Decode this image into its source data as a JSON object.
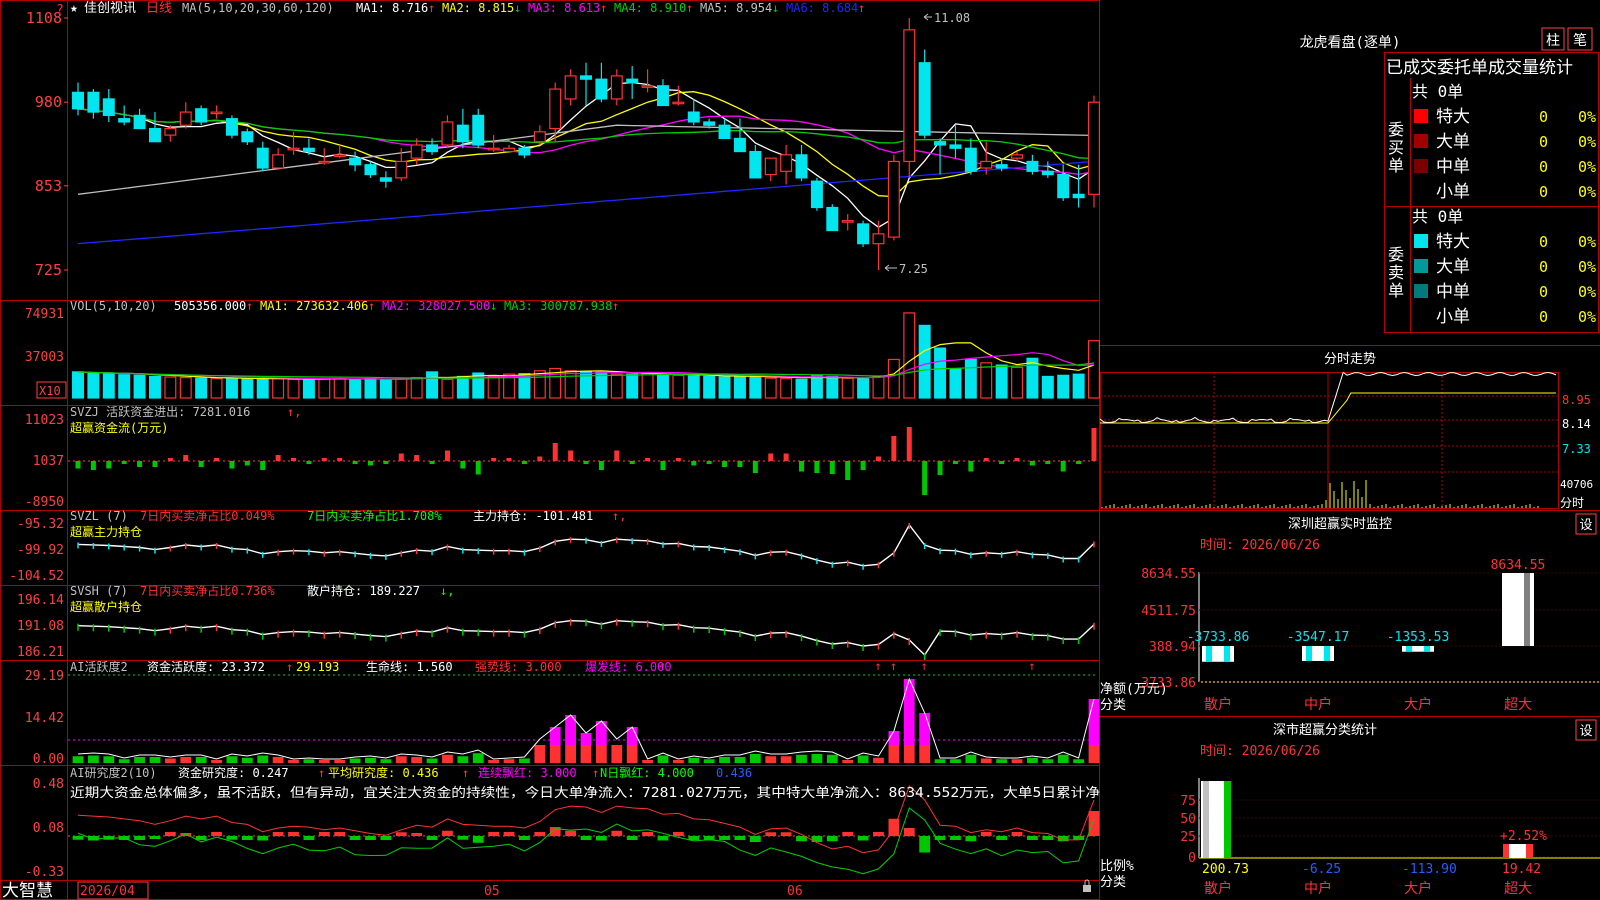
{
  "colors": {
    "up": "#ff3232",
    "down": "#00e5ee",
    "grid": "#b40000",
    "axis": "#ff4040",
    "white": "#ffffff",
    "yellow": "#ffff00",
    "magenta": "#ff00ff",
    "green": "#00d000",
    "gray": "#c0c0c0",
    "blue": "#1e28ff",
    "chinaGreen": "#00c800"
  },
  "header": {
    "star": "★",
    "stock": "佳创视讯",
    "period": "日线",
    "close_btn": "?"
  },
  "ma_label": "MA(5,10,20,30,60,120)",
  "ma_values": [
    {
      "label": "MA1: 8.716",
      "arrow": "↑",
      "color": "#ffffff"
    },
    {
      "label": "MA2: 8.815",
      "arrow": "↓",
      "color": "#ffff00"
    },
    {
      "label": "MA3: 8.613",
      "arrow": "↑",
      "color": "#ff00ff"
    },
    {
      "label": "MA4: 8.910",
      "arrow": "↑",
      "color": "#00d000"
    },
    {
      "label": "MA5: 8.954",
      "arrow": "↓",
      "color": "#c0c0c0"
    },
    {
      "label": "MA6: 8.684",
      "arrow": "↑",
      "color": "#1e28ff"
    }
  ],
  "price_axis": [
    "1108",
    "980",
    "853",
    "725"
  ],
  "price_axis_values": [
    11.08,
    9.8,
    8.53,
    7.25
  ],
  "high_label": "11.08",
  "low_label": "7.25",
  "vol": {
    "title": "VOL(5,10,20)",
    "values": [
      {
        "label": "505356.000",
        "arrow": "↑",
        "color": "#ffffff"
      },
      {
        "label": "MA1: 273632.406",
        "arrow": "↑",
        "color": "#ffff00"
      },
      {
        "label": "MA2: 328027.500",
        "arrow": "↓",
        "color": "#ff00ff"
      },
      {
        "label": "MA3: 300787.938",
        "arrow": "↑",
        "color": "#00d000"
      }
    ],
    "axis": [
      "74931",
      "37003"
    ],
    "unit": "X10"
  },
  "svzj": {
    "line1": "SVZJ  活跃资金进出: 7281.016",
    "arrow": "↑,",
    "line2": "超赢资金流(万元)",
    "axis": [
      "11023",
      "1037",
      "-8950"
    ]
  },
  "svzl": {
    "name": "SVZL (7)",
    "p1": "7日内买卖净占比0.049%",
    "p2": "7日内买卖净占比1.708%",
    "p3": "主力持仓: -101.481",
    "arrow": "↑,",
    "line2": "超赢主力持仓",
    "axis": [
      "-95.32",
      "-99.92",
      "-104.52"
    ]
  },
  "svsh": {
    "name": "SVSH (7)",
    "p1": "7日内买卖净占比0.736%",
    "p2": "散户持仓: 189.227",
    "arrow": "↓,",
    "line2": "超赢散户持仓",
    "axis": [
      "196.14",
      "191.08",
      "186.21"
    ]
  },
  "ai1": {
    "name": "AI活跃度2",
    "p1": "资金活跃度: 23.372",
    "a1": "↑",
    "p2": "29.193",
    "p3": "生命线: 1.560",
    "p4": "强势线: 3.000",
    "p5": "爆发线: 6.000",
    "axis": [
      "29.19",
      "14.42",
      "0.00"
    ]
  },
  "ai2": {
    "name": "AI研究度2(10)",
    "p1": "资金研究度: 0.247",
    "a1": "↑",
    "p2": "平均研究度: 0.436",
    "a2": "↑",
    "p3": "连续飘红: 3.000",
    "a3": "↑",
    "p4": "N日飘红: 4.000",
    "p5": "0.436",
    "commentary": "近期大资金总体偏多，虽不活跃，但有异动，宜关注大资金的持续性，今日大单净流入：7281.027万元，其中特大单净流入：8634.552万元，大单5日累计净",
    "axis": [
      "0.48",
      "0.08",
      "-0.33"
    ]
  },
  "bottom": {
    "brand": "大智慧",
    "date": "2026/04",
    "m5": "05",
    "m6": "06"
  },
  "lhb": {
    "title": "龙虎看盘(逐单)",
    "btn1": "柱",
    "btn2": "笔",
    "table_title": "已成交委托单成交量统计",
    "buy": {
      "side": [
        "委",
        "买",
        "单"
      ],
      "count": "共 0单",
      "rows": [
        {
          "name": "特大",
          "v": "0",
          "p": "0%",
          "c": "#ff0000"
        },
        {
          "name": "大单",
          "v": "0",
          "p": "0%",
          "c": "#a00000"
        },
        {
          "name": "中单",
          "v": "0",
          "p": "0%",
          "c": "#7a0000"
        },
        {
          "name": "小单",
          "v": "0",
          "p": "0%",
          "c": ""
        }
      ]
    },
    "sell": {
      "side": [
        "委",
        "卖",
        "单"
      ],
      "count": "共 0单",
      "rows": [
        {
          "name": "特大",
          "v": "0",
          "p": "0%",
          "c": "#00e5ee"
        },
        {
          "name": "大单",
          "v": "0",
          "p": "0%",
          "c": "#009a9a"
        },
        {
          "name": "中单",
          "v": "0",
          "p": "0%",
          "c": "#007a7a"
        },
        {
          "name": "小单",
          "v": "0",
          "p": "0%",
          "c": ""
        }
      ]
    }
  },
  "intraday": {
    "title": "分时走势",
    "axis": [
      "8.95",
      "8.14",
      "7.33"
    ],
    "vol_label": "40706",
    "unit": "分时"
  },
  "monitor": {
    "title": "深圳超赢实时监控",
    "btn": "设",
    "date": "时间: 2026/06/26",
    "ylabel1": "净额(万元)",
    "ylabel2": "分类",
    "axis": [
      "8634.55",
      "4511.75",
      "388.94",
      "-3733.86"
    ],
    "categories": [
      "散户",
      "中户",
      "大户",
      "超大"
    ],
    "values": [
      "-3733.86",
      "-3547.17",
      "-1353.53",
      "8634.55"
    ]
  },
  "classify": {
    "title": "深市超赢分类统计",
    "btn": "设",
    "date": "时间: 2026/06/26",
    "ylabel1": "比例%",
    "ylabel2": "分类",
    "axis": [
      "75",
      "50",
      "25",
      "0"
    ],
    "categories": [
      "散户",
      "中户",
      "大户",
      "超大"
    ],
    "values": [
      "200.73",
      "-6.25",
      "-113.90",
      "19.42"
    ],
    "extra": "+2.52%"
  },
  "chart_data": [
    {
      "type": "candlestick",
      "title": "佳创视讯 日线",
      "ylim": [
        7.25,
        11.08
      ],
      "ohlc": [
        [
          9.95,
          10.1,
          9.6,
          9.7
        ],
        [
          9.95,
          10.0,
          9.55,
          9.65
        ],
        [
          9.85,
          10.0,
          9.5,
          9.6
        ],
        [
          9.55,
          9.75,
          9.45,
          9.5
        ],
        [
          9.6,
          9.7,
          9.4,
          9.4
        ],
        [
          9.4,
          9.65,
          9.2,
          9.2
        ],
        [
          9.3,
          9.45,
          9.2,
          9.4
        ],
        [
          9.45,
          9.8,
          9.4,
          9.65
        ],
        [
          9.7,
          9.75,
          9.45,
          9.5
        ],
        [
          9.65,
          9.75,
          9.55,
          9.65
        ],
        [
          9.55,
          9.6,
          9.25,
          9.3
        ],
        [
          9.35,
          9.4,
          9.15,
          9.2
        ],
        [
          9.1,
          9.2,
          8.75,
          8.8
        ],
        [
          8.8,
          9.1,
          8.8,
          9.0
        ],
        [
          9.1,
          9.35,
          9.0,
          9.1
        ],
        [
          9.1,
          9.25,
          9.0,
          9.05
        ],
        [
          8.9,
          9.1,
          8.85,
          8.9
        ],
        [
          9.0,
          9.15,
          8.95,
          9.0
        ],
        [
          8.95,
          9.05,
          8.75,
          8.85
        ],
        [
          8.85,
          8.9,
          8.65,
          8.7
        ],
        [
          8.65,
          8.75,
          8.5,
          8.6
        ],
        [
          8.65,
          9.1,
          8.6,
          8.9
        ],
        [
          8.95,
          9.25,
          8.85,
          9.15
        ],
        [
          9.15,
          9.25,
          9.0,
          9.05
        ],
        [
          9.15,
          9.6,
          9.1,
          9.5
        ],
        [
          9.45,
          9.7,
          9.1,
          9.2
        ],
        [
          9.6,
          9.7,
          9.1,
          9.15
        ],
        [
          9.1,
          9.3,
          9.05,
          9.1
        ],
        [
          9.05,
          9.15,
          9.05,
          9.1
        ],
        [
          9.1,
          9.15,
          8.95,
          9.0
        ],
        [
          9.2,
          9.45,
          9.15,
          9.35
        ],
        [
          9.4,
          10.1,
          9.2,
          10.0
        ],
        [
          9.85,
          10.3,
          9.75,
          10.2
        ],
        [
          10.2,
          10.4,
          9.75,
          10.15
        ],
        [
          10.15,
          10.4,
          9.8,
          9.85
        ],
        [
          9.85,
          10.3,
          9.75,
          10.2
        ],
        [
          10.15,
          10.35,
          9.85,
          10.1
        ],
        [
          10.05,
          10.3,
          9.95,
          10.05
        ],
        [
          10.05,
          10.15,
          9.75,
          9.75
        ],
        [
          9.8,
          10.05,
          9.75,
          9.8
        ],
        [
          9.65,
          9.85,
          9.45,
          9.5
        ],
        [
          9.5,
          9.55,
          9.4,
          9.45
        ],
        [
          9.45,
          9.55,
          9.25,
          9.25
        ],
        [
          9.25,
          9.55,
          9.05,
          9.05
        ],
        [
          9.05,
          9.15,
          8.65,
          8.65
        ],
        [
          8.7,
          8.95,
          8.6,
          8.95
        ],
        [
          8.75,
          9.15,
          8.55,
          9.0
        ],
        [
          9.0,
          9.15,
          8.6,
          8.65
        ],
        [
          8.6,
          8.65,
          8.15,
          8.2
        ],
        [
          8.2,
          8.25,
          7.85,
          7.85
        ],
        [
          8.0,
          8.1,
          7.85,
          8.0
        ],
        [
          7.95,
          8.0,
          7.6,
          7.65
        ],
        [
          7.65,
          8.0,
          7.25,
          7.8
        ],
        [
          7.75,
          9.0,
          7.7,
          8.9
        ],
        [
          8.9,
          11.08,
          8.65,
          10.9
        ],
        [
          10.4,
          10.6,
          9.25,
          9.3
        ],
        [
          9.2,
          9.25,
          8.7,
          9.15
        ],
        [
          9.15,
          9.45,
          8.95,
          9.1
        ],
        [
          9.1,
          9.25,
          8.7,
          8.75
        ],
        [
          8.8,
          9.2,
          8.7,
          8.9
        ],
        [
          8.85,
          8.95,
          8.75,
          8.8
        ],
        [
          8.95,
          9.05,
          8.9,
          9.0
        ],
        [
          8.9,
          9.0,
          8.7,
          8.75
        ],
        [
          8.75,
          8.9,
          8.65,
          8.7
        ],
        [
          8.7,
          8.85,
          8.3,
          8.35
        ],
        [
          8.4,
          8.85,
          8.2,
          8.35
        ],
        [
          8.4,
          9.9,
          8.2,
          9.8
        ]
      ]
    },
    {
      "type": "bar",
      "title": "VOL(5,10,20)",
      "ylim": [
        0,
        74931
      ],
      "values": [
        23000,
        22000,
        21500,
        20500,
        20000,
        19000,
        18500,
        18000,
        17500,
        17000,
        17500,
        17000,
        16500,
        17000,
        16500,
        16500,
        17000,
        17000,
        16500,
        17000,
        16000,
        17000,
        18000,
        23000,
        16500,
        19000,
        22000,
        19000,
        21000,
        21500,
        24000,
        26000,
        24000,
        23000,
        22500,
        21000,
        21000,
        21500,
        20500,
        20000,
        19500,
        19000,
        18500,
        19000,
        19500,
        17500,
        17000,
        16500,
        19500,
        19000,
        17500,
        17000,
        18500,
        34000,
        75000,
        64000,
        44000,
        26000,
        34000,
        31000,
        29000,
        27000,
        35000,
        19000,
        20000,
        21000,
        50500
      ]
    }
  ]
}
